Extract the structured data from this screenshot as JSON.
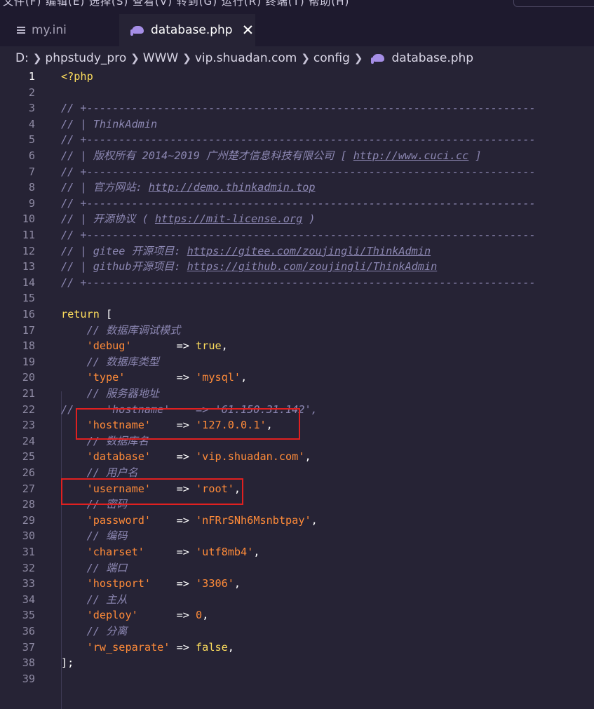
{
  "menu": {
    "fragment": "文件(F)   编辑(E)   选择(S)   查看(V)   转到(G)   运行(R)   终端(T)   帮助(H)"
  },
  "tabs": [
    {
      "label": "my.ini",
      "icon": "lines-icon"
    },
    {
      "label": "database.php",
      "icon": "php-elephant-icon",
      "active": true,
      "close": "✕"
    }
  ],
  "breadcrumb": [
    "D:",
    "phpstudy_pro",
    "WWW",
    "vip.shuadan.com",
    "config",
    "database.php"
  ],
  "active_line": 1,
  "colors": {
    "background": "#262335",
    "comment": "#8c87b2",
    "string": "#ff8b39",
    "keyword": "#fede5d",
    "highlight": "#e02020"
  },
  "lines": [
    {
      "n": "1",
      "t": [
        [
          "php",
          "<?php"
        ]
      ]
    },
    {
      "n": "2",
      "t": []
    },
    {
      "n": "3",
      "t": [
        [
          "comment",
          "// +----------------------------------------------------------------------"
        ]
      ]
    },
    {
      "n": "4",
      "t": [
        [
          "comment",
          "// | ThinkAdmin"
        ]
      ]
    },
    {
      "n": "5",
      "t": [
        [
          "comment",
          "// +----------------------------------------------------------------------"
        ]
      ]
    },
    {
      "n": "6",
      "t": [
        [
          "comment",
          "// | 版权所有 2014~2019 广州楚才信息科技有限公司 [ "
        ],
        [
          "link",
          "http://www.cuci.cc"
        ],
        [
          "comment",
          " ]"
        ]
      ]
    },
    {
      "n": "7",
      "t": [
        [
          "comment",
          "// +----------------------------------------------------------------------"
        ]
      ]
    },
    {
      "n": "8",
      "t": [
        [
          "comment",
          "// | 官方网站: "
        ],
        [
          "link",
          "http://demo.thinkadmin.top"
        ]
      ]
    },
    {
      "n": "9",
      "t": [
        [
          "comment",
          "// +----------------------------------------------------------------------"
        ]
      ]
    },
    {
      "n": "10",
      "t": [
        [
          "comment",
          "// | 开源协议 ( "
        ],
        [
          "link",
          "https://mit-license.org"
        ],
        [
          "comment",
          " )"
        ]
      ]
    },
    {
      "n": "11",
      "t": [
        [
          "comment",
          "// +----------------------------------------------------------------------"
        ]
      ]
    },
    {
      "n": "12",
      "t": [
        [
          "comment",
          "// | gitee 开源项目: "
        ],
        [
          "link",
          "https://gitee.com/zoujingli/ThinkAdmin"
        ]
      ]
    },
    {
      "n": "13",
      "t": [
        [
          "comment",
          "// | github开源项目: "
        ],
        [
          "link",
          "https://github.com/zoujingli/ThinkAdmin"
        ]
      ]
    },
    {
      "n": "14",
      "t": [
        [
          "comment",
          "// +----------------------------------------------------------------------"
        ]
      ]
    },
    {
      "n": "15",
      "t": []
    },
    {
      "n": "16",
      "t": [
        [
          "kw",
          "return"
        ],
        [
          "punct",
          " ["
        ]
      ]
    },
    {
      "n": "17",
      "t": [
        [
          "plain",
          "    "
        ],
        [
          "comment",
          "// 数据库调试模式"
        ]
      ]
    },
    {
      "n": "18",
      "t": [
        [
          "plain",
          "    "
        ],
        [
          "key",
          "'debug'"
        ],
        [
          "punct",
          "       => "
        ],
        [
          "bool",
          "true"
        ],
        [
          "punct",
          ","
        ]
      ]
    },
    {
      "n": "19",
      "t": [
        [
          "plain",
          "    "
        ],
        [
          "comment",
          "// 数据库类型"
        ]
      ]
    },
    {
      "n": "20",
      "t": [
        [
          "plain",
          "    "
        ],
        [
          "key",
          "'type'"
        ],
        [
          "punct",
          "        => "
        ],
        [
          "str",
          "'mysql'"
        ],
        [
          "punct",
          ","
        ]
      ]
    },
    {
      "n": "21",
      "t": [
        [
          "plain",
          "    "
        ],
        [
          "comment",
          "// 服务器地址"
        ]
      ]
    },
    {
      "n": "22",
      "t": [
        [
          "comment",
          "//     'hostname'    => '61.150.31.142',"
        ]
      ]
    },
    {
      "n": "23",
      "t": [
        [
          "plain",
          "    "
        ],
        [
          "key",
          "'hostname'"
        ],
        [
          "punct",
          "    => "
        ],
        [
          "str",
          "'127.0.0.1'"
        ],
        [
          "punct",
          ","
        ]
      ]
    },
    {
      "n": "24",
      "t": [
        [
          "plain",
          "    "
        ],
        [
          "comment",
          "// 数据库名"
        ]
      ]
    },
    {
      "n": "25",
      "t": [
        [
          "plain",
          "    "
        ],
        [
          "key",
          "'database'"
        ],
        [
          "punct",
          "    => "
        ],
        [
          "str",
          "'vip.shuadan.com'"
        ],
        [
          "punct",
          ","
        ]
      ]
    },
    {
      "n": "26",
      "t": [
        [
          "plain",
          "    "
        ],
        [
          "comment",
          "// 用户名"
        ]
      ]
    },
    {
      "n": "27",
      "t": [
        [
          "plain",
          "    "
        ],
        [
          "key",
          "'username'"
        ],
        [
          "punct",
          "    => "
        ],
        [
          "str",
          "'root'"
        ],
        [
          "punct",
          ","
        ]
      ]
    },
    {
      "n": "28",
      "t": [
        [
          "plain",
          "    "
        ],
        [
          "comment",
          "// 密码"
        ]
      ]
    },
    {
      "n": "29",
      "t": [
        [
          "plain",
          "    "
        ],
        [
          "key",
          "'password'"
        ],
        [
          "punct",
          "    => "
        ],
        [
          "str",
          "'nFRrSNh6Msnbtpay'"
        ],
        [
          "punct",
          ","
        ]
      ]
    },
    {
      "n": "30",
      "t": [
        [
          "plain",
          "    "
        ],
        [
          "comment",
          "// 编码"
        ]
      ]
    },
    {
      "n": "31",
      "t": [
        [
          "plain",
          "    "
        ],
        [
          "key",
          "'charset'"
        ],
        [
          "punct",
          "     => "
        ],
        [
          "str",
          "'utf8mb4'"
        ],
        [
          "punct",
          ","
        ]
      ]
    },
    {
      "n": "32",
      "t": [
        [
          "plain",
          "    "
        ],
        [
          "comment",
          "// 端口"
        ]
      ]
    },
    {
      "n": "33",
      "t": [
        [
          "plain",
          "    "
        ],
        [
          "key",
          "'hostport'"
        ],
        [
          "punct",
          "    => "
        ],
        [
          "str",
          "'3306'"
        ],
        [
          "punct",
          ","
        ]
      ]
    },
    {
      "n": "34",
      "t": [
        [
          "plain",
          "    "
        ],
        [
          "comment",
          "// 主从"
        ]
      ]
    },
    {
      "n": "35",
      "t": [
        [
          "plain",
          "    "
        ],
        [
          "key",
          "'deploy'"
        ],
        [
          "punct",
          "      => "
        ],
        [
          "str",
          "0"
        ],
        [
          "punct",
          ","
        ]
      ]
    },
    {
      "n": "36",
      "t": [
        [
          "plain",
          "    "
        ],
        [
          "comment",
          "// 分离"
        ]
      ]
    },
    {
      "n": "37",
      "t": [
        [
          "plain",
          "    "
        ],
        [
          "key",
          "'rw_separate'"
        ],
        [
          "punct",
          " => "
        ],
        [
          "bool",
          "false"
        ],
        [
          "punct",
          ","
        ]
      ]
    },
    {
      "n": "38",
      "t": [
        [
          "punct",
          "];"
        ]
      ]
    },
    {
      "n": "39",
      "t": []
    }
  ]
}
